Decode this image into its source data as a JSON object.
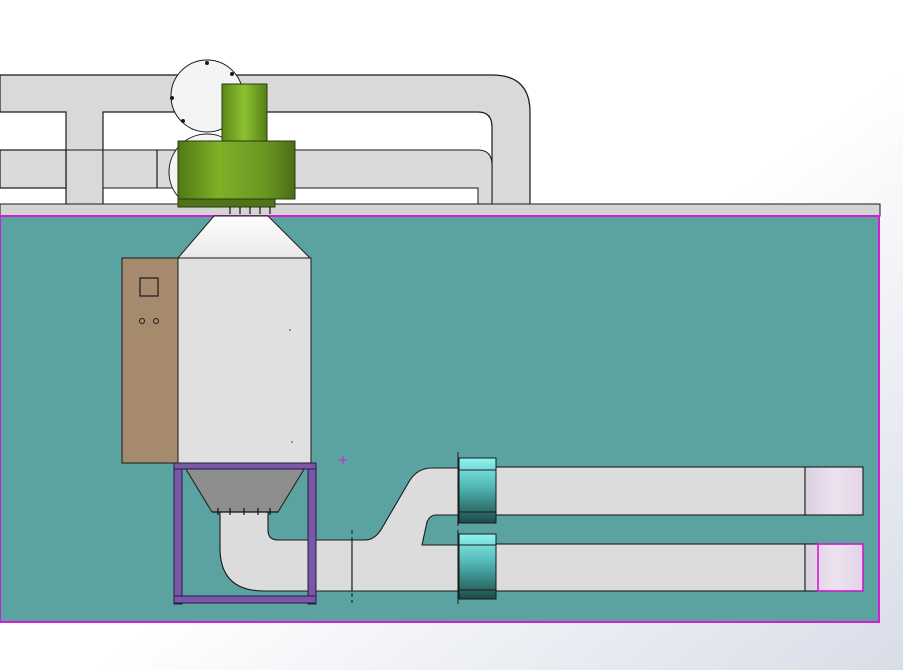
{
  "viewport": {
    "background_gradient": [
      "#ffffff",
      "#ffffff",
      "#d9dee9"
    ]
  },
  "colors": {
    "wall_teal": "#5ba3a1",
    "wall_border_magenta": "#d21fd2",
    "duct_gray": "#d9d9d9",
    "duct_outline": "#1a1a1a",
    "collector_body": "#e0e0e0",
    "control_panel": "#a58a6e",
    "hopper_gray": "#8e8e8e",
    "stand_purple": "#7a58a8",
    "fan_green": "#6e9a22",
    "inline_fan_cyan": "#7fe9e6",
    "inline_fan_dark": "#1f4f4d",
    "outlet_tint": "#e2d3e6"
  },
  "parts": {
    "wall_panel": "wall",
    "overhead_duct": "duct",
    "dust_collector": "collector",
    "control_cabinet": "cabinet",
    "blower": "blower-fan",
    "hopper": "hopper",
    "support_frame": "frame",
    "inline_fans": "inline-fans",
    "branch_ducts": "branch-ducts",
    "sketch_origin": "origin-marker"
  }
}
